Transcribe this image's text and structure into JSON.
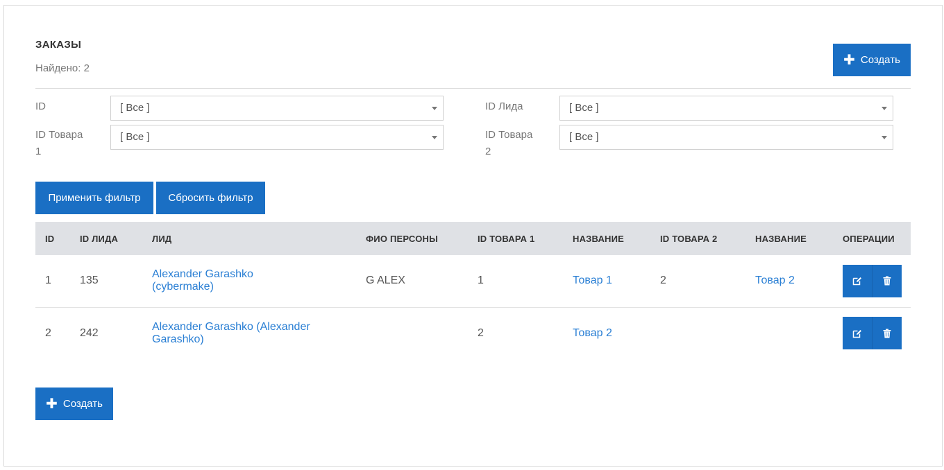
{
  "header": {
    "title": "ЗАКАЗЫ",
    "found_label": "Найдено: 2",
    "create_label": "Создать"
  },
  "filters": [
    {
      "label": "ID",
      "value": "[ Все ]"
    },
    {
      "label": "ID Лида",
      "value": "[ Все ]"
    },
    {
      "label": "ID Товара 1",
      "value": "[ Все ]"
    },
    {
      "label": "ID Товара 2",
      "value": "[ Все ]"
    }
  ],
  "filter_buttons": {
    "apply": "Применить фильтр",
    "reset": "Сбросить фильтр"
  },
  "table": {
    "columns": [
      "ID",
      "ID ЛИДА",
      "ЛИД",
      "ФИО ПЕРСОНЫ",
      "ID ТОВАРА 1",
      "НАЗВАНИЕ",
      "ID ТОВАРА 2",
      "НАЗВАНИЕ",
      "ОПЕРАЦИИ"
    ],
    "rows": [
      {
        "id": "1",
        "lead_id": "135",
        "lead_line1": "Alexander Garashko",
        "lead_line2": "(cybermake)",
        "person": "G ALEX",
        "product1_id": "1",
        "product1_name": "Товар 1",
        "product2_id": "2",
        "product2_name": "Товар 2"
      },
      {
        "id": "2",
        "lead_id": "242",
        "lead_line1": "Alexander Garashko (Alexander",
        "lead_line2": "Garashko)",
        "person": "",
        "product1_id": "2",
        "product1_name": "Товар 2",
        "product2_id": "",
        "product2_name": ""
      }
    ]
  },
  "footer": {
    "create_label": "Создать"
  },
  "icons": {
    "plus": "plus-icon",
    "edit": "edit-icon",
    "delete": "trash-icon"
  },
  "colors": {
    "primary": "#1a6fc4",
    "link": "#2a7fd4",
    "header_bg": "#dfe1e5"
  }
}
